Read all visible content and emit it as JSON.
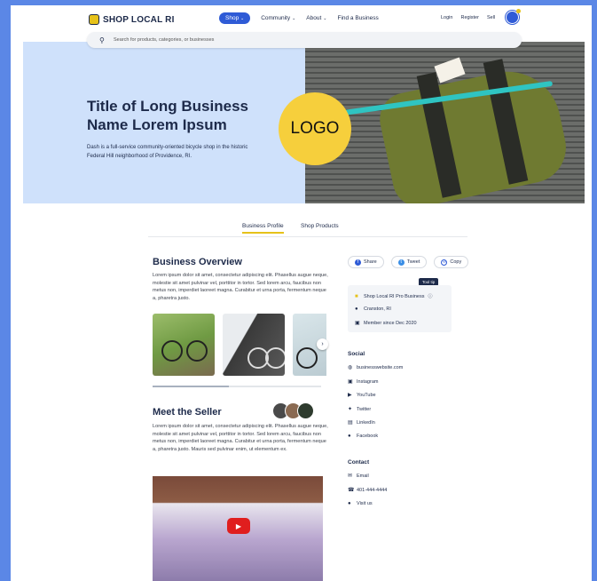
{
  "header": {
    "brand": "SHOP LOCAL RI",
    "nav": [
      {
        "label": "Shop",
        "chevron": true,
        "active": true
      },
      {
        "label": "Community",
        "chevron": true
      },
      {
        "label": "About",
        "chevron": true
      },
      {
        "label": "Find a Business",
        "chevron": false
      }
    ],
    "right_links": [
      "Login",
      "Register",
      "Sell"
    ],
    "search_placeholder": "Search for products, categories, or businesses"
  },
  "hero": {
    "title": "Title of Long Business Name Lorem Ipsum",
    "description": "Dash is a full-service community-oriented bicycle shop in the historic Federal Hill neighborhood of Providence, RI.",
    "logo_text": "LOGO"
  },
  "tabs": [
    {
      "label": "Business Profile",
      "active": true
    },
    {
      "label": "Shop Products",
      "active": false
    }
  ],
  "overview": {
    "heading": "Business Overview",
    "text": "Lorem ipsum dolor sit amet, consectetur adipiscing elit. Phasellus augue neque, molestie sit amet pulvinar vel, porttitor in tortor. Sed lorem arcu, faucibus non metus non, imperdiet laoreet magna. Curabitur et urna porta, fermentum neque a, pharetra justo.",
    "gallery_progress": 0.45
  },
  "seller": {
    "heading": "Meet the Seller",
    "text": "Lorem ipsum dolor sit amet, consectetur adipiscing elit. Phasellus augue neque, molestie sit amet pulvinar vel, porttitor in tortor. Sed lorem arcu, faucibus non metus non, imperdiet laoreet magna. Curabitur et urna porta, fermentum neque a, pharetra justo. Mauris sed pulvinar enim, ut elementum ex."
  },
  "share": [
    {
      "label": "Share",
      "icon": "facebook-icon"
    },
    {
      "label": "Tweet",
      "icon": "twitter-icon"
    },
    {
      "label": "Copy",
      "icon": "link-icon"
    }
  ],
  "info": {
    "tooltip": "Tool tip",
    "pro_label": "Shop Local RI Pro Business",
    "location": "Cranston, RI",
    "member_since": "Member since Dec 2020"
  },
  "social": {
    "heading": "Social",
    "links": [
      {
        "label": "businesswebsite.com",
        "icon": "globe-icon"
      },
      {
        "label": "Instagram",
        "icon": "instagram-icon"
      },
      {
        "label": "YouTube",
        "icon": "youtube-icon"
      },
      {
        "label": "Twitter",
        "icon": "twitter-icon"
      },
      {
        "label": "LinkedIn",
        "icon": "linkedin-icon"
      },
      {
        "label": "Facebook",
        "icon": "facebook-icon"
      }
    ]
  },
  "contact": {
    "heading": "Contact",
    "links": [
      {
        "label": "Email",
        "icon": "mail-icon"
      },
      {
        "label": "401-444-4444",
        "icon": "phone-icon"
      },
      {
        "label": "Visit us",
        "icon": "map-pin-icon"
      }
    ]
  },
  "colors": {
    "accent": "#2f5bd6",
    "brand_yellow": "#e6c21a",
    "hero_bg": "#cfe1fb",
    "text_dark": "#1d2a4a"
  }
}
